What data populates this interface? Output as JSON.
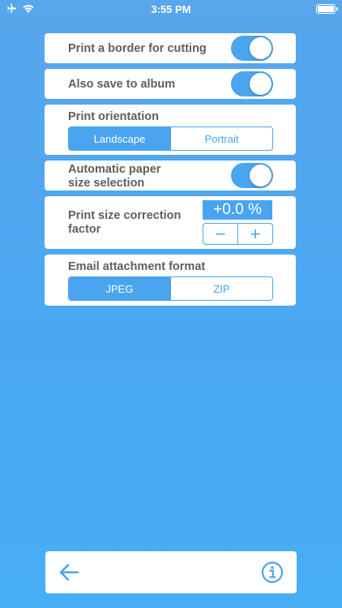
{
  "status_bar": {
    "time": "3:55 PM",
    "left_icons": [
      "airplane-icon",
      "wifi-icon"
    ],
    "right_icons": [
      "battery-icon"
    ]
  },
  "settings": {
    "border": {
      "label": "Print a border for cutting",
      "enabled": true
    },
    "album": {
      "label": "Also save to album",
      "enabled": true
    },
    "orientation": {
      "label": "Print orientation",
      "options": [
        "Landscape",
        "Portrait"
      ],
      "selected": "Landscape"
    },
    "auto_paper": {
      "label_line1": "Automatic paper",
      "label_line2": "size selection",
      "enabled": true
    },
    "size_correction": {
      "label_line1": "Print size correction",
      "label_line2": "factor",
      "value": "+0.0 %",
      "minus": "−",
      "plus": "+"
    },
    "email_format": {
      "label": "Email attachment format",
      "options": [
        "JPEG",
        "ZIP"
      ],
      "selected": "JPEG"
    }
  },
  "bottom_bar": {
    "icons": [
      "back-arrow-icon",
      "info-icon"
    ]
  },
  "colors": {
    "accent": "#4aa4ef",
    "background_top": "#58a6ec",
    "background_bottom": "#47aef6",
    "label_text": "#5f5f5f",
    "card": "#ffffff"
  }
}
